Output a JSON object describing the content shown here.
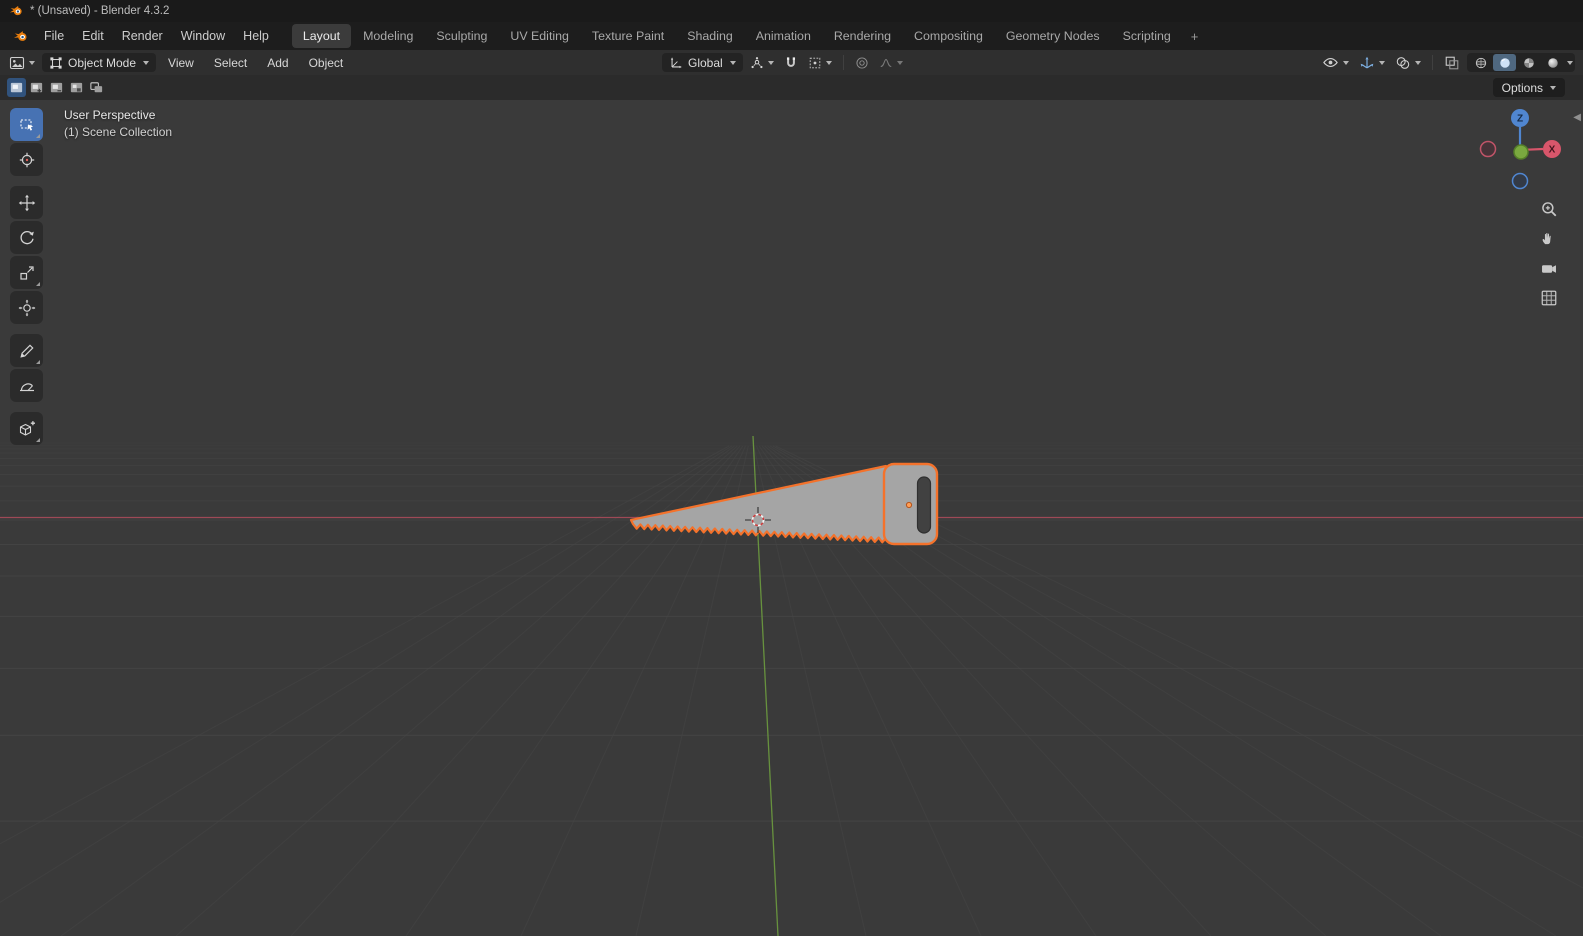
{
  "window": {
    "title": "* (Unsaved) - Blender 4.3.2"
  },
  "menubar": {
    "menus": [
      "File",
      "Edit",
      "Render",
      "Window",
      "Help"
    ],
    "workspaces": [
      "Layout",
      "Modeling",
      "Sculpting",
      "UV Editing",
      "Texture Paint",
      "Shading",
      "Animation",
      "Rendering",
      "Compositing",
      "Geometry Nodes",
      "Scripting"
    ],
    "active_workspace": "Layout",
    "add_tab": "+"
  },
  "header": {
    "mode": "Object Mode",
    "menus": [
      "View",
      "Select",
      "Add",
      "Object"
    ],
    "orientation": "Global"
  },
  "tool_settings": {
    "options": "Options"
  },
  "viewport": {
    "perspective_label": "User Perspective",
    "collection_label": "(1) Scene Collection"
  },
  "gizmo": {
    "z": "Z",
    "x": "X"
  },
  "colors": {
    "selection_outline": "#f4722b",
    "accent_blue": "#4772b3",
    "axis_x_red": "#c04f60",
    "axis_y_green": "#73a83f",
    "object_fill": "#a5a5a5"
  }
}
